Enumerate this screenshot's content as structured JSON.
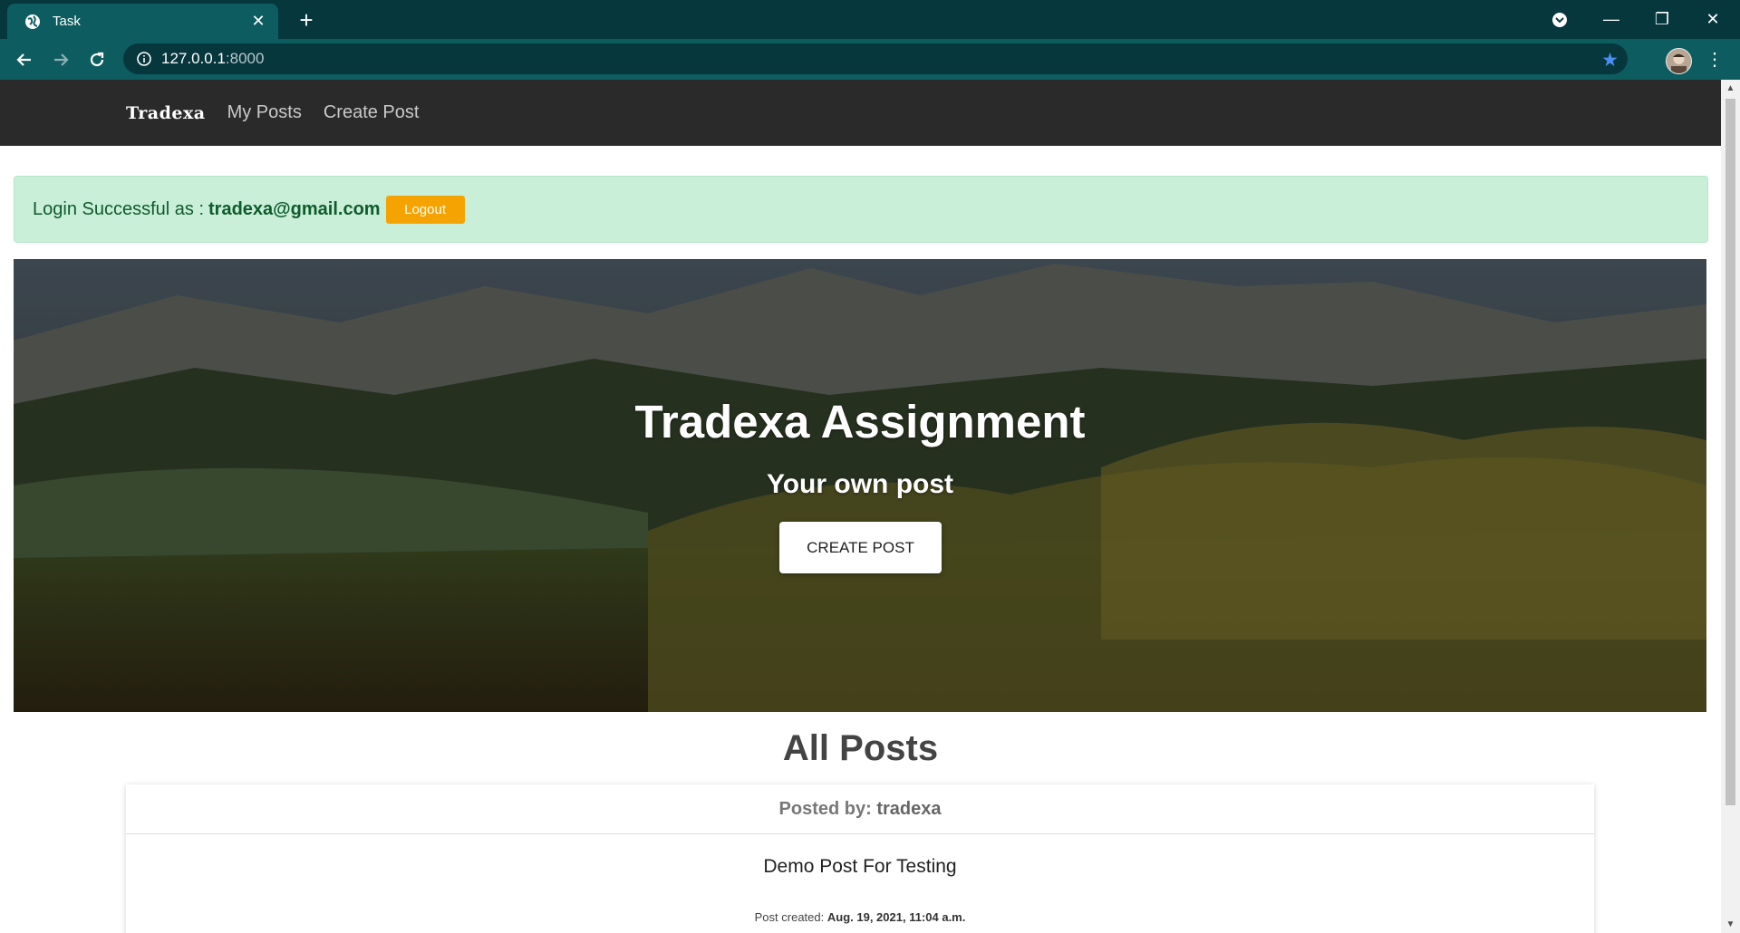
{
  "browser": {
    "tab_title": "Task",
    "tab_close": "✕",
    "new_tab": "+",
    "url_host": "127.0.0.1",
    "url_port": ":8000",
    "minimize": "—",
    "maximize": "❐",
    "close": "✕"
  },
  "navbar": {
    "brand": "Tradexa",
    "links": [
      "My Posts",
      "Create Post"
    ]
  },
  "alert": {
    "label": "Login Successful as :",
    "email": "tradexa@gmail.com",
    "logout_label": "Logout"
  },
  "hero": {
    "title": "Tradexa Assignment",
    "subtitle": "Your own post",
    "button_label": "CREATE POST"
  },
  "posts": {
    "heading": "All Posts",
    "items": [
      {
        "posted_by_label": "Posted by:",
        "author": "tradexa",
        "title": "Demo Post For Testing",
        "created_label": "Post created:",
        "created_at": "Aug. 19, 2021, 11:04 a.m."
      }
    ]
  },
  "colors": {
    "tabbar": "#06373d",
    "toolbar": "#0d5c60",
    "navbar": "#2a2a2a",
    "alert_bg": "#c9efd9",
    "alert_text": "#0f5a2a",
    "logout": "#f5a300"
  }
}
